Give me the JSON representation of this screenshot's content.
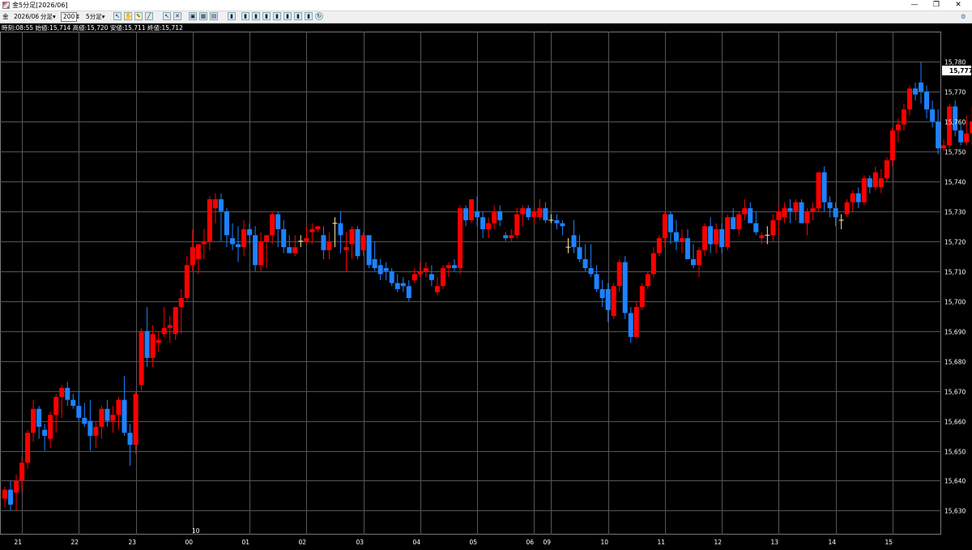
{
  "window": {
    "title": "金5分足[2026/06]",
    "minimize_glyph": "—",
    "restore_glyph": "❐",
    "close_glyph": "✕"
  },
  "toolbar": {
    "symbol": "金",
    "contract": "2026/06",
    "timeframe_label": "分足",
    "bars_value": "200",
    "period_label": "5分足",
    "dropdown_glyph": "▾"
  },
  "info_line": "時刻:08:55 始値:15,714 高値:15,720 安値:15,711 終値:15,712",
  "chart_data": {
    "type": "candlestick",
    "ylim": [
      15622,
      15790
    ],
    "y_ticks": [
      15630,
      15640,
      15650,
      15660,
      15670,
      15680,
      15690,
      15700,
      15710,
      15720,
      15730,
      15740,
      15750,
      15760,
      15770,
      15780
    ],
    "y_tick_labels": [
      "15,630",
      "15,640",
      "15,650",
      "15,660",
      "15,670",
      "15,680",
      "15,690",
      "15,700",
      "15,710",
      "15,720",
      "15,730",
      "15,740",
      "15,750",
      "15,760",
      "15,770",
      "15,780"
    ],
    "last_price_label": "15,777",
    "last_price": 15777,
    "x_labels": [
      "21",
      "22",
      "23",
      "00",
      "01",
      "02",
      "03",
      "04",
      "05",
      "06",
      "09",
      "10",
      "11",
      "12",
      "13",
      "14",
      "15"
    ],
    "x_label_bar_index": [
      3,
      13,
      23,
      33,
      43,
      53,
      63,
      73,
      83,
      93,
      96,
      106,
      116,
      126,
      136,
      146,
      156
    ],
    "date_marker": "10",
    "date_marker_bar_index": 33,
    "colors": {
      "up": "#ff0000",
      "down": "#1e82ff",
      "doji": "#ffe8a0",
      "grid": "#555555",
      "axis_text": "#ffffff"
    },
    "bars": [
      [
        15634,
        15638,
        15631,
        15637
      ],
      [
        15637,
        15640,
        15630,
        15632
      ],
      [
        15636,
        15642,
        15630,
        15640
      ],
      [
        15640,
        15648,
        15636,
        15646
      ],
      [
        15646,
        15657,
        15644,
        15656
      ],
      [
        15656,
        15667,
        15653,
        15664
      ],
      [
        15664,
        15665,
        15654,
        15658
      ],
      [
        15657,
        15659,
        15650,
        15655
      ],
      [
        15654,
        15663,
        15651,
        15662
      ],
      [
        15662,
        15669,
        15656,
        15668
      ],
      [
        15668,
        15672,
        15661,
        15671
      ],
      [
        15671,
        15673,
        15665,
        15667
      ],
      [
        15667,
        15669,
        15664,
        15665
      ],
      [
        15665,
        15670,
        15660,
        15661
      ],
      [
        15661,
        15666,
        15658,
        15659
      ],
      [
        15660,
        15667,
        15650,
        15655
      ],
      [
        15655,
        15660,
        15651,
        15658
      ],
      [
        15658,
        15665,
        15654,
        15664
      ],
      [
        15664,
        15667,
        15658,
        15660
      ],
      [
        15660,
        15665,
        15656,
        15662
      ],
      [
        15662,
        15668,
        15657,
        15667
      ],
      [
        15667,
        15675,
        15655,
        15656
      ],
      [
        15656,
        15659,
        15645,
        15652
      ],
      [
        15652,
        15670,
        15649,
        15669
      ],
      [
        15672,
        15691,
        15670,
        15690
      ],
      [
        15690,
        15698,
        15678,
        15681
      ],
      [
        15681,
        15692,
        15678,
        15689
      ],
      [
        15686,
        15690,
        15683,
        15687
      ],
      [
        15689,
        15698,
        15688,
        15691
      ],
      [
        15691,
        15695,
        15686,
        15692
      ],
      [
        15689,
        15692,
        15687,
        15698
      ],
      [
        15698,
        15704,
        15689,
        15701
      ],
      [
        15701,
        15715,
        15700,
        15712
      ],
      [
        15712,
        15724,
        15710,
        15718
      ],
      [
        15714,
        15718,
        15709,
        15719
      ],
      [
        15719,
        15724,
        15714,
        15720
      ],
      [
        15720,
        15735,
        15717,
        15734
      ],
      [
        15731,
        15736,
        15726,
        15734
      ],
      [
        15734,
        15736,
        15720,
        15730
      ],
      [
        15730,
        15731,
        15718,
        15722
      ],
      [
        15721,
        15726,
        15717,
        15719
      ],
      [
        15719,
        15725,
        15713,
        15718
      ],
      [
        15718,
        15727,
        15715,
        15724
      ],
      [
        15724,
        15726,
        15719,
        15722
      ],
      [
        15722,
        15725,
        15710,
        15712
      ],
      [
        15712,
        15723,
        15710,
        15720
      ],
      [
        15720,
        15722,
        15711,
        15722
      ],
      [
        15722,
        15730,
        15719,
        15729
      ],
      [
        15729,
        15730,
        15718,
        15724
      ],
      [
        15724,
        15727,
        15716,
        15718
      ],
      [
        15718,
        15722,
        15716,
        15716
      ],
      [
        15716,
        15722,
        15715,
        15718
      ],
      [
        15720,
        15722,
        15718,
        15720
      ],
      [
        15720,
        15725,
        15719,
        15721
      ],
      [
        15723,
        15726,
        15719,
        15724
      ],
      [
        15724,
        15725,
        15723,
        15725
      ],
      [
        15722,
        15725,
        15714,
        15717
      ],
      [
        15717,
        15723,
        15714,
        15720
      ],
      [
        15726,
        15728,
        15718,
        15726
      ],
      [
        15726,
        15730,
        15716,
        15722
      ],
      [
        15717,
        15723,
        15710,
        15718
      ],
      [
        15719,
        15725,
        15714,
        15724
      ],
      [
        15724,
        15725,
        15714,
        15715
      ],
      [
        15717,
        15723,
        15715,
        15722
      ],
      [
        15722,
        15722,
        15711,
        15712
      ],
      [
        15714,
        15720,
        15710,
        15711
      ],
      [
        15712,
        15714,
        15707,
        15709
      ],
      [
        15711,
        15713,
        15707,
        15710
      ],
      [
        15710,
        15711,
        15705,
        15706
      ],
      [
        15706,
        15709,
        15703,
        15704
      ],
      [
        15706,
        15708,
        15703,
        15705
      ],
      [
        15705,
        15707,
        15700,
        15701
      ],
      [
        15707,
        15711,
        15706,
        15709
      ],
      [
        15709,
        15713,
        15708,
        15710
      ],
      [
        15710,
        15713,
        15708,
        15711
      ],
      [
        15709,
        15712,
        15705,
        15707
      ],
      [
        15703,
        15708,
        15702,
        15705
      ],
      [
        15705,
        15712,
        15704,
        15711
      ],
      [
        15711,
        15713,
        15708,
        15712
      ],
      [
        15712,
        15714,
        15710,
        15711
      ],
      [
        15711,
        15732,
        15709,
        15731
      ],
      [
        15731,
        15732,
        15725,
        15727
      ],
      [
        15727,
        15734,
        15726,
        15734
      ],
      [
        15730,
        15735,
        15725,
        15728
      ],
      [
        15728,
        15730,
        15721,
        15724
      ],
      [
        15724,
        15728,
        15721,
        15726
      ],
      [
        15726,
        15732,
        15724,
        15730
      ],
      [
        15730,
        15732,
        15725,
        15727
      ],
      [
        15722,
        15723,
        15720,
        15721
      ],
      [
        15721,
        15724,
        15720,
        15722
      ],
      [
        15722,
        15731,
        15721,
        15729
      ],
      [
        15729,
        15732,
        15725,
        15731
      ],
      [
        15731,
        15732,
        15727,
        15728
      ],
      [
        15728,
        15731,
        15726,
        15730
      ],
      [
        15728,
        15734,
        15727,
        15731
      ],
      [
        15731,
        15733,
        15726,
        15727
      ],
      [
        15727,
        15729,
        15726,
        15727
      ],
      [
        15727,
        15729,
        15724,
        15726
      ],
      [
        15726,
        15727,
        15722,
        15725
      ],
      [
        15718,
        15721,
        15716,
        15718
      ],
      [
        15722,
        15727,
        15716,
        15718
      ],
      [
        15718,
        15722,
        15713,
        15714
      ],
      [
        15714,
        15719,
        15710,
        15711
      ],
      [
        15711,
        15719,
        15708,
        15709
      ],
      [
        15709,
        15712,
        15703,
        15704
      ],
      [
        15704,
        15707,
        15698,
        15701
      ],
      [
        15704,
        15706,
        15693,
        15697
      ],
      [
        15695,
        15706,
        15694,
        15705
      ],
      [
        15705,
        15714,
        15703,
        15713
      ],
      [
        15713,
        15715,
        15694,
        15696
      ],
      [
        15696,
        15698,
        15686,
        15688
      ],
      [
        15688,
        15700,
        15688,
        15698
      ],
      [
        15698,
        15706,
        15697,
        15705
      ],
      [
        15705,
        15710,
        15704,
        15709
      ],
      [
        15709,
        15718,
        15708,
        15716
      ],
      [
        15716,
        15722,
        15715,
        15721
      ],
      [
        15721,
        15730,
        15718,
        15729
      ],
      [
        15729,
        15730,
        15719,
        15723
      ],
      [
        15723,
        15727,
        15717,
        15720
      ],
      [
        15720,
        15724,
        15716,
        15721
      ],
      [
        15721,
        15724,
        15714,
        15714
      ],
      [
        15714,
        15719,
        15711,
        15712
      ],
      [
        15712,
        15718,
        15708,
        15717
      ],
      [
        15717,
        15726,
        15715,
        15725
      ],
      [
        15725,
        15728,
        15716,
        15719
      ],
      [
        15719,
        15726,
        15716,
        15724
      ],
      [
        15724,
        15726,
        15716,
        15718
      ],
      [
        15718,
        15729,
        15717,
        15728
      ],
      [
        15728,
        15731,
        15726,
        15724
      ],
      [
        15724,
        15730,
        15722,
        15729
      ],
      [
        15729,
        15734,
        15727,
        15731
      ],
      [
        15731,
        15733,
        15727,
        15726
      ],
      [
        15726,
        15730,
        15722,
        15723
      ],
      [
        15721,
        15723,
        15719,
        15722
      ],
      [
        15722,
        15725,
        15719,
        15722
      ],
      [
        15722,
        15729,
        15720,
        15727
      ],
      [
        15727,
        15732,
        15722,
        15730
      ],
      [
        15728,
        15733,
        15726,
        15731
      ],
      [
        15731,
        15734,
        15726,
        15730
      ],
      [
        15730,
        15734,
        15727,
        15733
      ],
      [
        15733,
        15734,
        15728,
        15726
      ],
      [
        15726,
        15731,
        15722,
        15730
      ],
      [
        15730,
        15733,
        15727,
        15731
      ],
      [
        15731,
        15743,
        15730,
        15743
      ],
      [
        15743,
        15745,
        15730,
        15733
      ],
      [
        15733,
        15735,
        15728,
        15731
      ],
      [
        15731,
        15733,
        15725,
        15728
      ],
      [
        15727,
        15729,
        15724,
        15727
      ],
      [
        15729,
        15734,
        15728,
        15733
      ],
      [
        15733,
        15737,
        15730,
        15736
      ],
      [
        15736,
        15738,
        15731,
        15733
      ],
      [
        15733,
        15742,
        15732,
        15741
      ],
      [
        15741,
        15742,
        15736,
        15738
      ],
      [
        15738,
        15745,
        15737,
        15743
      ],
      [
        15738,
        15744,
        15736,
        15741
      ],
      [
        15741,
        15748,
        15740,
        15747
      ],
      [
        15747,
        15758,
        15745,
        15757
      ],
      [
        15757,
        15761,
        15753,
        15759
      ],
      [
        15759,
        15766,
        15757,
        15764
      ],
      [
        15764,
        15772,
        15762,
        15771
      ],
      [
        15771,
        15773,
        15767,
        15769
      ],
      [
        15773,
        15780,
        15766,
        15770
      ],
      [
        15770,
        15772,
        15761,
        15764
      ],
      [
        15764,
        15767,
        15758,
        15760
      ],
      [
        15760,
        15764,
        15749,
        15751
      ],
      [
        15751,
        15754,
        15750,
        15752
      ],
      [
        15752,
        15766,
        15751,
        15765
      ],
      [
        15765,
        15767,
        15755,
        15757
      ],
      [
        15757,
        15759,
        15752,
        15753
      ],
      [
        15753,
        15762,
        15752,
        15756
      ],
      [
        15756,
        15765,
        15752,
        15760
      ],
      [
        15760,
        15773,
        15758,
        15772
      ],
      [
        15774,
        15776,
        15768,
        15774
      ],
      [
        15774,
        15778,
        15770,
        15772
      ],
      [
        15772,
        15781,
        15770,
        15776
      ],
      [
        15776,
        15778,
        15772,
        15773
      ],
      [
        15773,
        15777,
        15771,
        15775
      ],
      [
        15775,
        15778,
        15773,
        15777
      ],
      [
        15777,
        15779,
        15775,
        15777
      ]
    ]
  }
}
